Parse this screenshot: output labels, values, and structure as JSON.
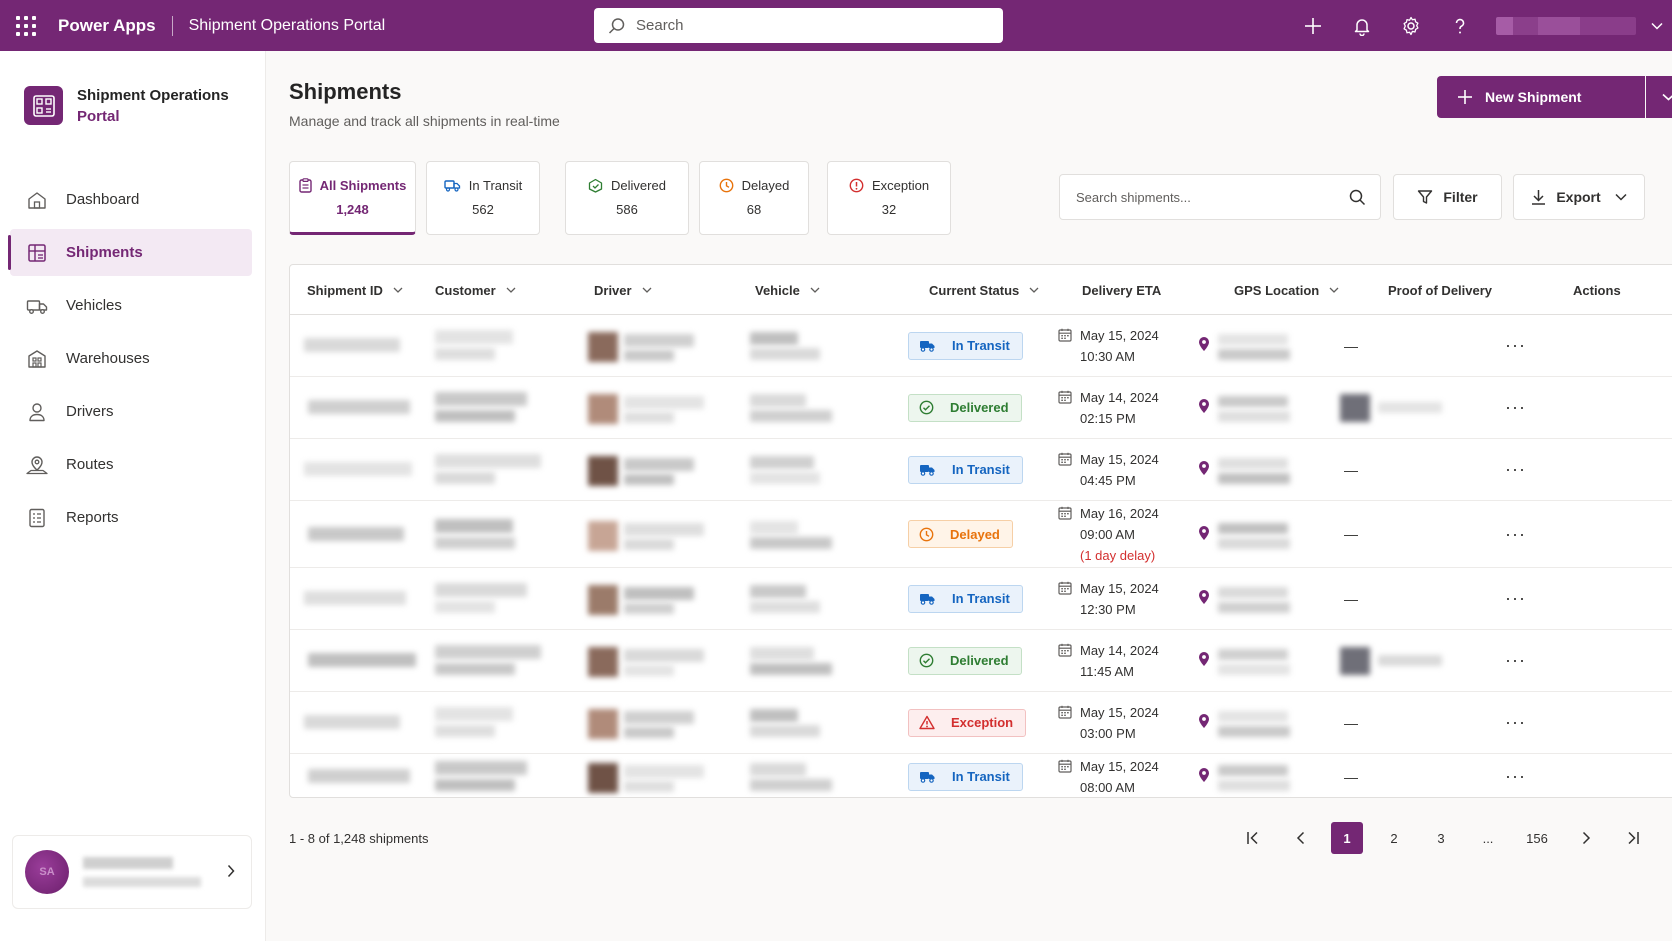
{
  "topbar": {
    "brand": "Power Apps",
    "app_name": "Shipment Operations Portal",
    "search_placeholder": "Search"
  },
  "sidebar": {
    "app_title_line1": "Shipment Operations",
    "app_title_line2": "Portal",
    "items": [
      {
        "label": "Dashboard",
        "icon": "home-icon"
      },
      {
        "label": "Shipments",
        "icon": "grid-icon",
        "active": true
      },
      {
        "label": "Vehicles",
        "icon": "truck-icon"
      },
      {
        "label": "Warehouses",
        "icon": "building-icon"
      },
      {
        "label": "Drivers",
        "icon": "person-icon"
      },
      {
        "label": "Routes",
        "icon": "route-icon"
      },
      {
        "label": "Reports",
        "icon": "document-icon"
      }
    ],
    "user_initials": "SA"
  },
  "main": {
    "title": "Shipments",
    "subtitle": "Manage and track all shipments in real-time",
    "new_button": "New Shipment",
    "search_placeholder": "Search shipments...",
    "filter_label": "Filter",
    "export_label": "Export"
  },
  "stats": [
    {
      "label": "All Shipments",
      "value": "1,248",
      "icon": "clipboard-icon",
      "color": "#742774"
    },
    {
      "label": "In Transit",
      "value": "562",
      "icon": "truck-icon",
      "color": "#1565c0"
    },
    {
      "label": "Delivered",
      "value": "586",
      "icon": "box-check-icon",
      "color": "#2e7d32"
    },
    {
      "label": "Delayed",
      "value": "68",
      "icon": "clock-icon",
      "color": "#e8730c"
    },
    {
      "label": "Exception",
      "value": "32",
      "icon": "alert-circle-icon",
      "color": "#d32f2f"
    }
  ],
  "table": {
    "columns": [
      "Shipment ID",
      "Customer",
      "Driver",
      "Vehicle",
      "Current Status",
      "Delivery ETA",
      "GPS Location",
      "Proof of Delivery",
      "Actions"
    ],
    "rows": [
      {
        "status": "In Transit",
        "eta_date": "May 15, 2024",
        "eta_time": "10:30 AM",
        "pod": "—"
      },
      {
        "status": "Delivered",
        "eta_date": "May 14, 2024",
        "eta_time": "02:15 PM",
        "pod": ""
      },
      {
        "status": "In Transit",
        "eta_date": "May 15, 2024",
        "eta_time": "04:45 PM",
        "pod": "—"
      },
      {
        "status": "Delayed",
        "eta_date": "May 16, 2024",
        "eta_time": "09:00 AM",
        "eta_note": "(1 day delay)",
        "pod": "—"
      },
      {
        "status": "In Transit",
        "eta_date": "May 15, 2024",
        "eta_time": "12:30 PM",
        "pod": "—"
      },
      {
        "status": "Delivered",
        "eta_date": "May 14, 2024",
        "eta_time": "11:45 AM",
        "pod": ""
      },
      {
        "status": "Exception",
        "eta_date": "May 15, 2024",
        "eta_time": "03:00 PM",
        "pod": "—"
      },
      {
        "status": "In Transit",
        "eta_date": "May 15, 2024",
        "eta_time": "08:00 AM",
        "pod": "—"
      }
    ],
    "row_action": "···"
  },
  "pager": {
    "info": "1 - 8 of 1,248 shipments",
    "pages": [
      "1",
      "2",
      "3",
      "...",
      "156"
    ],
    "current": "1"
  },
  "colors": {
    "brand": "#742774",
    "transit": "#1565c0",
    "delivered": "#2e7d32",
    "delayed": "#e8730c",
    "exception": "#d32f2f"
  }
}
